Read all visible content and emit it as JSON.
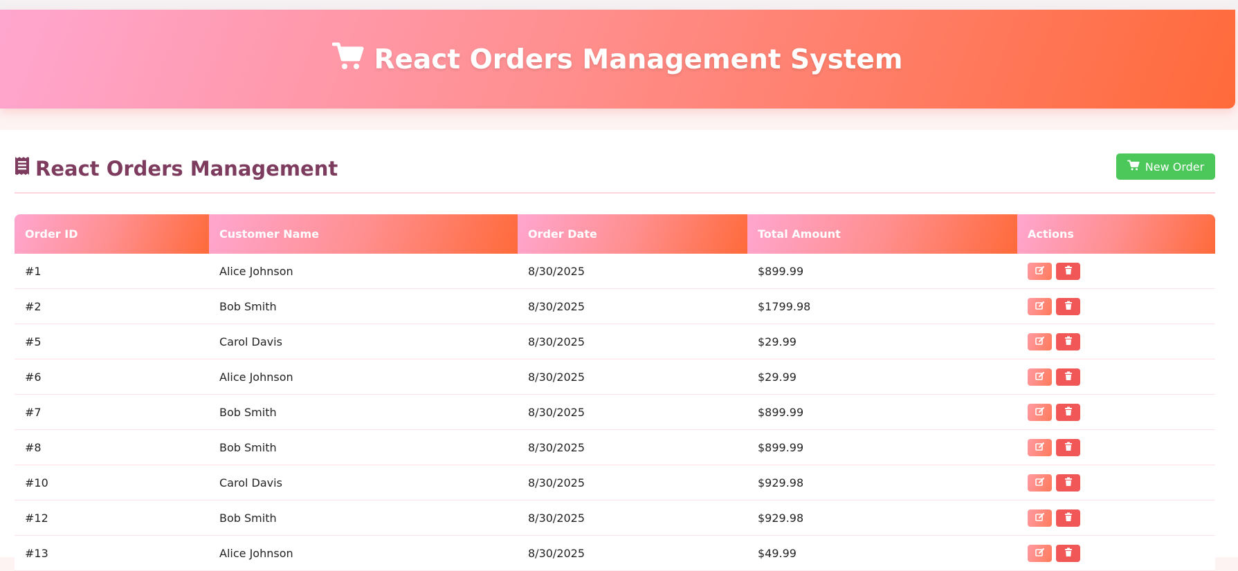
{
  "header": {
    "title": "React Orders Management System",
    "icon": "shopping-cart-icon",
    "gradient": [
      "#ffa6cf",
      "#ff8f8f",
      "#ff6a3a"
    ]
  },
  "section": {
    "title": "React Orders Management",
    "icon": "receipt-icon",
    "title_color": "#7d3b5e"
  },
  "toolbar": {
    "new_order_label": "New Order",
    "new_order_color": "#4cc85a"
  },
  "table": {
    "columns": [
      "Order ID",
      "Customer Name",
      "Order Date",
      "Total Amount",
      "Actions"
    ],
    "rows": [
      {
        "id": "#1",
        "customer": "Alice Johnson",
        "date": "8/30/2025",
        "total": "$899.99"
      },
      {
        "id": "#2",
        "customer": "Bob Smith",
        "date": "8/30/2025",
        "total": "$1799.98"
      },
      {
        "id": "#5",
        "customer": "Carol Davis",
        "date": "8/30/2025",
        "total": "$29.99"
      },
      {
        "id": "#6",
        "customer": "Alice Johnson",
        "date": "8/30/2025",
        "total": "$29.99"
      },
      {
        "id": "#7",
        "customer": "Bob Smith",
        "date": "8/30/2025",
        "total": "$899.99"
      },
      {
        "id": "#8",
        "customer": "Bob Smith",
        "date": "8/30/2025",
        "total": "$899.99"
      },
      {
        "id": "#10",
        "customer": "Carol Davis",
        "date": "8/30/2025",
        "total": "$929.98"
      },
      {
        "id": "#12",
        "customer": "Bob Smith",
        "date": "8/30/2025",
        "total": "$929.98"
      },
      {
        "id": "#13",
        "customer": "Alice Johnson",
        "date": "8/30/2025",
        "total": "$49.99"
      }
    ],
    "row_action_icons": [
      "edit-icon",
      "trash-icon"
    ]
  }
}
